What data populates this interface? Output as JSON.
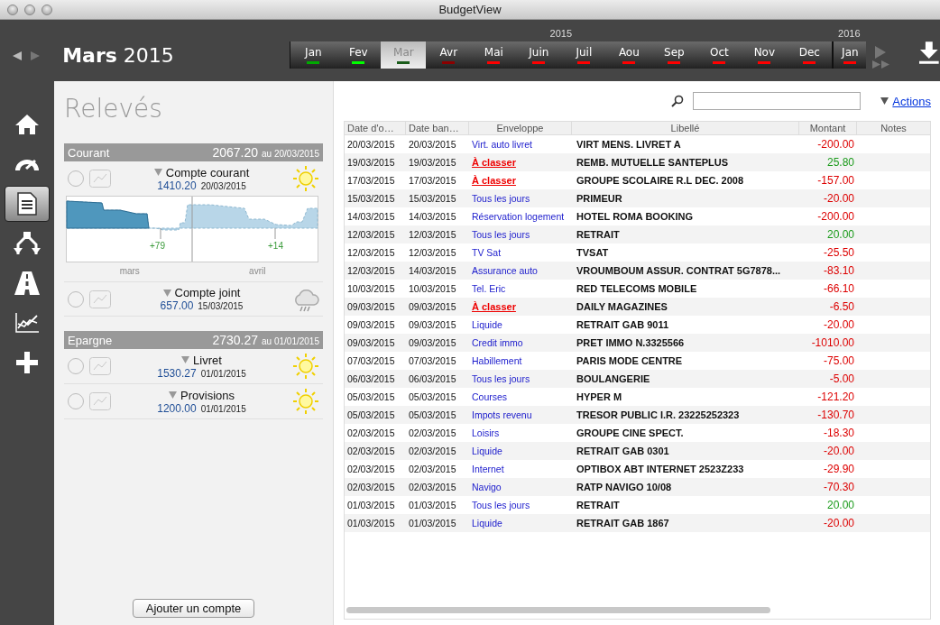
{
  "window": {
    "title": "BudgetView"
  },
  "header": {
    "period": "**Mars** 2015"
  },
  "years": [
    {
      "label": "2015",
      "months": [
        {
          "label": "Jan",
          "color": "#00aa00",
          "selected": false
        },
        {
          "label": "Fev",
          "color": "#00ff00",
          "selected": false
        },
        {
          "label": "Mar",
          "color": "#1a5c1a",
          "selected": true
        },
        {
          "label": "Avr",
          "color": "#8b0000",
          "selected": false
        },
        {
          "label": "Mai",
          "color": "#ff0000",
          "selected": false
        },
        {
          "label": "Juin",
          "color": "#ff0000",
          "selected": false
        },
        {
          "label": "Juil",
          "color": "#ff0000",
          "selected": false
        },
        {
          "label": "Aou",
          "color": "#ff0000",
          "selected": false
        },
        {
          "label": "Sep",
          "color": "#ff0000",
          "selected": false
        },
        {
          "label": "Oct",
          "color": "#ff0000",
          "selected": false
        },
        {
          "label": "Nov",
          "color": "#ff0000",
          "selected": false
        },
        {
          "label": "Dec",
          "color": "#ff0000",
          "selected": false
        }
      ]
    },
    {
      "label": "2016",
      "months": [
        {
          "label": "Jan",
          "color": "#ff0000",
          "selected": false
        }
      ]
    }
  ],
  "sidebar": {
    "items": [
      {
        "kind": "home",
        "selected": false
      },
      {
        "kind": "gauge",
        "selected": false
      },
      {
        "kind": "document",
        "selected": true
      },
      {
        "kind": "split",
        "selected": false
      },
      {
        "kind": "road",
        "selected": false
      },
      {
        "kind": "chart",
        "selected": false
      },
      {
        "kind": "add",
        "selected": false
      }
    ]
  },
  "accounts_panel": {
    "title": "Relevés",
    "groups": [
      {
        "name": "Courant",
        "total": "2067.20",
        "date": "au 20/03/2015",
        "accounts": [
          {
            "name": "Compte courant",
            "amount": "1410.20",
            "date": "20/03/2015",
            "selected": false,
            "sunny": true,
            "graph": {
              "markers": [
                "+79",
                "+14"
              ],
              "months": [
                "mars",
                "avril"
              ]
            }
          },
          {
            "name": "Compte joint",
            "amount": "657.00",
            "date": "15/03/2015",
            "selected": false,
            "sunny": false
          }
        ]
      },
      {
        "name": "Epargne",
        "total": "2730.27",
        "date": "au 01/01/2015",
        "accounts": [
          {
            "name": "Livret",
            "amount": "1530.27",
            "date": "01/01/2015",
            "selected": false,
            "sunny": true
          },
          {
            "name": "Provisions",
            "amount": "1200.00",
            "date": "01/01/2015",
            "selected": false,
            "sunny": true
          }
        ]
      }
    ],
    "add_button": "Ajouter un compte"
  },
  "toolbar": {
    "actions": "Actions"
  },
  "table": {
    "columns": [
      "Date d'o…",
      "Date ban…",
      "Enveloppe",
      "Libellé",
      "Montant",
      "Notes"
    ],
    "rows": [
      {
        "date_op": "20/03/2015",
        "date_bank": "20/03/2015",
        "envelope": "Virt. auto livret",
        "unclassified": false,
        "label": "VIRT MENS. LIVRET A",
        "amount": "-200.00",
        "credit": false
      },
      {
        "date_op": "19/03/2015",
        "date_bank": "19/03/2015",
        "envelope": "À classer",
        "unclassified": true,
        "label": "REMB. MUTUELLE SANTEPLUS",
        "amount": "25.80",
        "credit": true
      },
      {
        "date_op": "17/03/2015",
        "date_bank": "17/03/2015",
        "envelope": "À classer",
        "unclassified": true,
        "label": "GROUPE SCOLAIRE R.L DEC. 2008",
        "amount": "-157.00",
        "credit": false
      },
      {
        "date_op": "15/03/2015",
        "date_bank": "15/03/2015",
        "envelope": "Tous les jours",
        "unclassified": false,
        "label": "PRIMEUR",
        "amount": "-20.00",
        "credit": false
      },
      {
        "date_op": "14/03/2015",
        "date_bank": "14/03/2015",
        "envelope": "Réservation logement",
        "unclassified": false,
        "label": "HOTEL ROMA BOOKING",
        "amount": "-200.00",
        "credit": false
      },
      {
        "date_op": "12/03/2015",
        "date_bank": "12/03/2015",
        "envelope": "Tous les jours",
        "unclassified": false,
        "label": "RETRAIT",
        "amount": "20.00",
        "credit": true
      },
      {
        "date_op": "12/03/2015",
        "date_bank": "12/03/2015",
        "envelope": "TV Sat",
        "unclassified": false,
        "label": "TVSAT",
        "amount": "-25.50",
        "credit": false
      },
      {
        "date_op": "12/03/2015",
        "date_bank": "14/03/2015",
        "envelope": "Assurance auto",
        "unclassified": false,
        "label": "VROUMBOUM ASSUR. CONTRAT 5G7878...",
        "amount": "-83.10",
        "credit": false
      },
      {
        "date_op": "10/03/2015",
        "date_bank": "10/03/2015",
        "envelope": "Tel. Eric",
        "unclassified": false,
        "label": "RED TELECOMS MOBILE",
        "amount": "-66.10",
        "credit": false
      },
      {
        "date_op": "09/03/2015",
        "date_bank": "09/03/2015",
        "envelope": "À classer",
        "unclassified": true,
        "label": "DAILY MAGAZINES",
        "amount": "-6.50",
        "credit": false
      },
      {
        "date_op": "09/03/2015",
        "date_bank": "09/03/2015",
        "envelope": "Liquide",
        "unclassified": false,
        "label": "RETRAIT GAB 9011",
        "amount": "-20.00",
        "credit": false
      },
      {
        "date_op": "09/03/2015",
        "date_bank": "09/03/2015",
        "envelope": "Credit immo",
        "unclassified": false,
        "label": "PRET IMMO N.3325566",
        "amount": "-1010.00",
        "credit": false
      },
      {
        "date_op": "07/03/2015",
        "date_bank": "07/03/2015",
        "envelope": "Habillement",
        "unclassified": false,
        "label": "PARIS MODE CENTRE",
        "amount": "-75.00",
        "credit": false
      },
      {
        "date_op": "06/03/2015",
        "date_bank": "06/03/2015",
        "envelope": "Tous les jours",
        "unclassified": false,
        "label": "BOULANGERIE",
        "amount": "-5.00",
        "credit": false
      },
      {
        "date_op": "05/03/2015",
        "date_bank": "05/03/2015",
        "envelope": "Courses",
        "unclassified": false,
        "label": "HYPER M",
        "amount": "-121.20",
        "credit": false
      },
      {
        "date_op": "05/03/2015",
        "date_bank": "05/03/2015",
        "envelope": "Impots revenu",
        "unclassified": false,
        "label": "TRESOR PUBLIC I.R. 23225252323",
        "amount": "-130.70",
        "credit": false
      },
      {
        "date_op": "02/03/2015",
        "date_bank": "02/03/2015",
        "envelope": "Loisirs",
        "unclassified": false,
        "label": "GROUPE CINE SPECT.",
        "amount": "-18.30",
        "credit": false
      },
      {
        "date_op": "02/03/2015",
        "date_bank": "02/03/2015",
        "envelope": "Liquide",
        "unclassified": false,
        "label": "RETRAIT GAB 0301",
        "amount": "-20.00",
        "credit": false
      },
      {
        "date_op": "02/03/2015",
        "date_bank": "02/03/2015",
        "envelope": "Internet",
        "unclassified": false,
        "label": "OPTIBOX ABT INTERNET 2523Z233",
        "amount": "-29.90",
        "credit": false
      },
      {
        "date_op": "02/03/2015",
        "date_bank": "02/03/2015",
        "envelope": "Navigo",
        "unclassified": false,
        "label": "RATP NAVIGO 10/08",
        "amount": "-70.30",
        "credit": false
      },
      {
        "date_op": "01/03/2015",
        "date_bank": "01/03/2015",
        "envelope": "Tous les jours",
        "unclassified": false,
        "label": "RETRAIT",
        "amount": "20.00",
        "credit": true
      },
      {
        "date_op": "01/03/2015",
        "date_bank": "01/03/2015",
        "envelope": "Liquide",
        "unclassified": false,
        "label": "RETRAIT GAB 1867",
        "amount": "-20.00",
        "credit": false
      }
    ]
  }
}
